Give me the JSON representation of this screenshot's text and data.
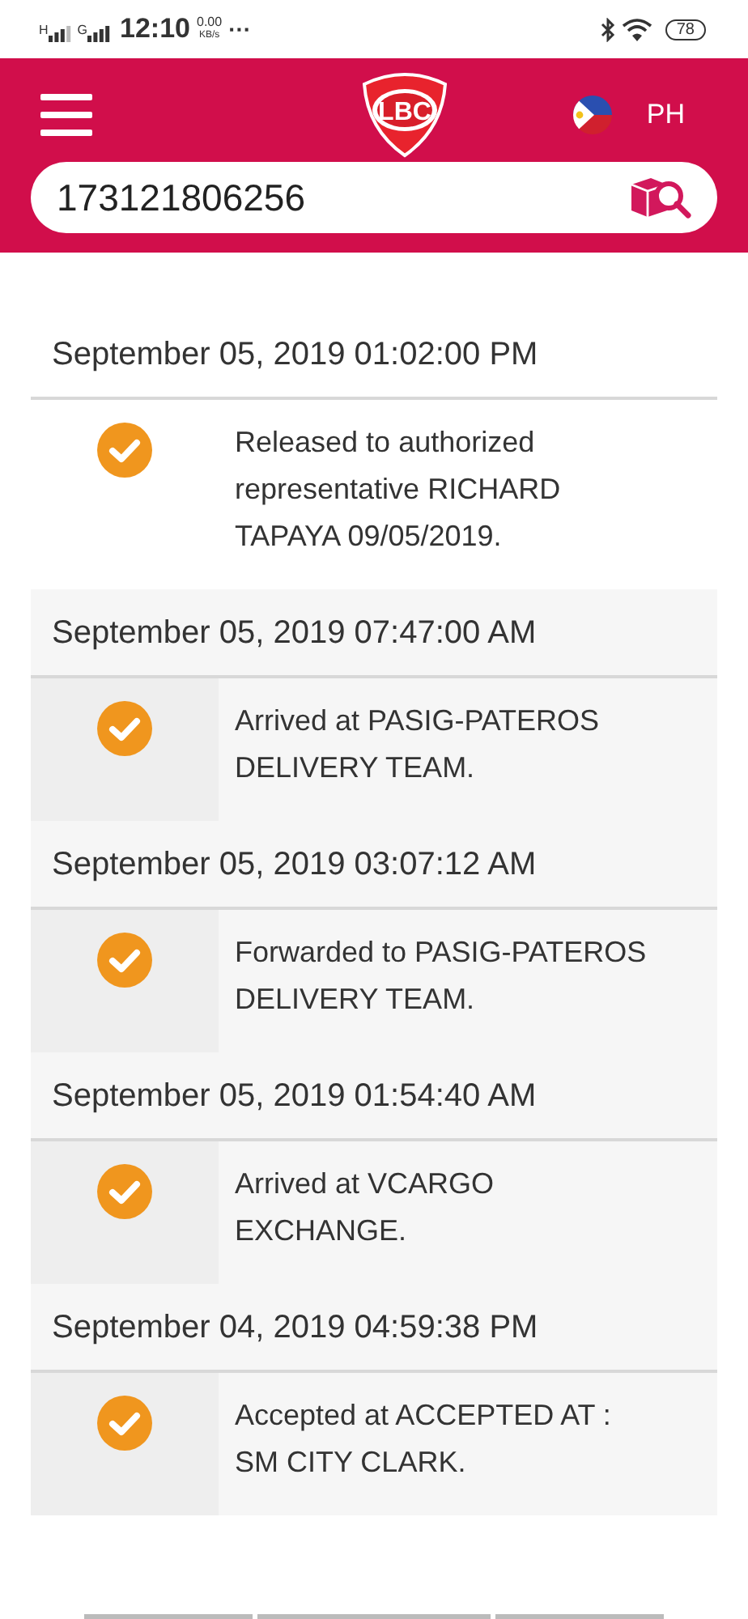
{
  "status_bar": {
    "network_1": "H",
    "network_2": "G",
    "time": "12:10",
    "speed": "0.00",
    "speed_unit": "KB/s",
    "more": "···",
    "battery": "78"
  },
  "header": {
    "logo_text": "LBC",
    "country": "PH"
  },
  "search": {
    "value": "173121806256"
  },
  "events": [
    {
      "kind": "latest",
      "datetime": "September 05, 2019 01:02:00 PM",
      "description": "Released to authorized representative RICHARD TAPAYA 09/05/2019."
    },
    {
      "kind": "previous",
      "datetime": "September 05, 2019 07:47:00 AM",
      "description": "Arrived at PASIG-PATEROS DELIVERY TEAM."
    },
    {
      "kind": "previous",
      "datetime": "September 05, 2019 03:07:12 AM",
      "description": "Forwarded to PASIG-PATEROS DELIVERY TEAM."
    },
    {
      "kind": "previous",
      "datetime": "September 05, 2019 01:54:40 AM",
      "description": "Arrived at VCARGO EXCHANGE."
    },
    {
      "kind": "previous",
      "datetime": "September 04, 2019 04:59:38 PM",
      "description": "Accepted at ACCEPTED AT : SM CITY CLARK."
    }
  ]
}
